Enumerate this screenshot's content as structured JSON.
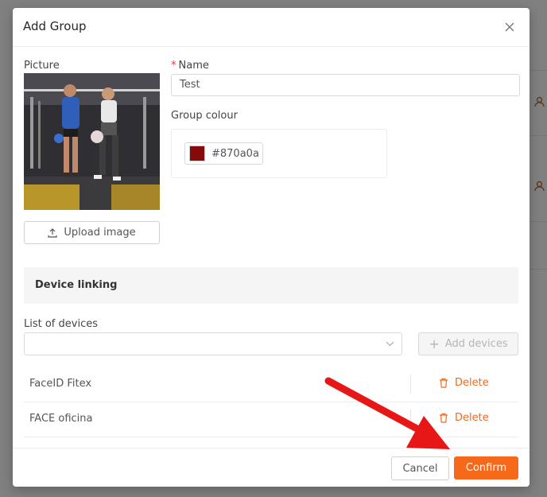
{
  "modal": {
    "title": "Add Group"
  },
  "picture": {
    "label": "Picture",
    "upload_label": "Upload image"
  },
  "name_field": {
    "required_mark": "*",
    "label": "Name",
    "value": "Test"
  },
  "group_colour": {
    "label": "Group colour",
    "value": "#870a0a"
  },
  "device_linking": {
    "section_title": "Device linking",
    "list_label": "List of devices",
    "select_value": "",
    "add_devices_label": "Add devices",
    "devices": [
      {
        "name": "FaceID Fitex",
        "delete_label": "Delete"
      },
      {
        "name": "FACE oficina",
        "delete_label": "Delete"
      }
    ]
  },
  "footer": {
    "cancel_label": "Cancel",
    "confirm_label": "Confirm"
  },
  "colors": {
    "accent": "#f6691b",
    "danger_text": "#ef6a1f",
    "annotation_arrow": "#e81717"
  }
}
